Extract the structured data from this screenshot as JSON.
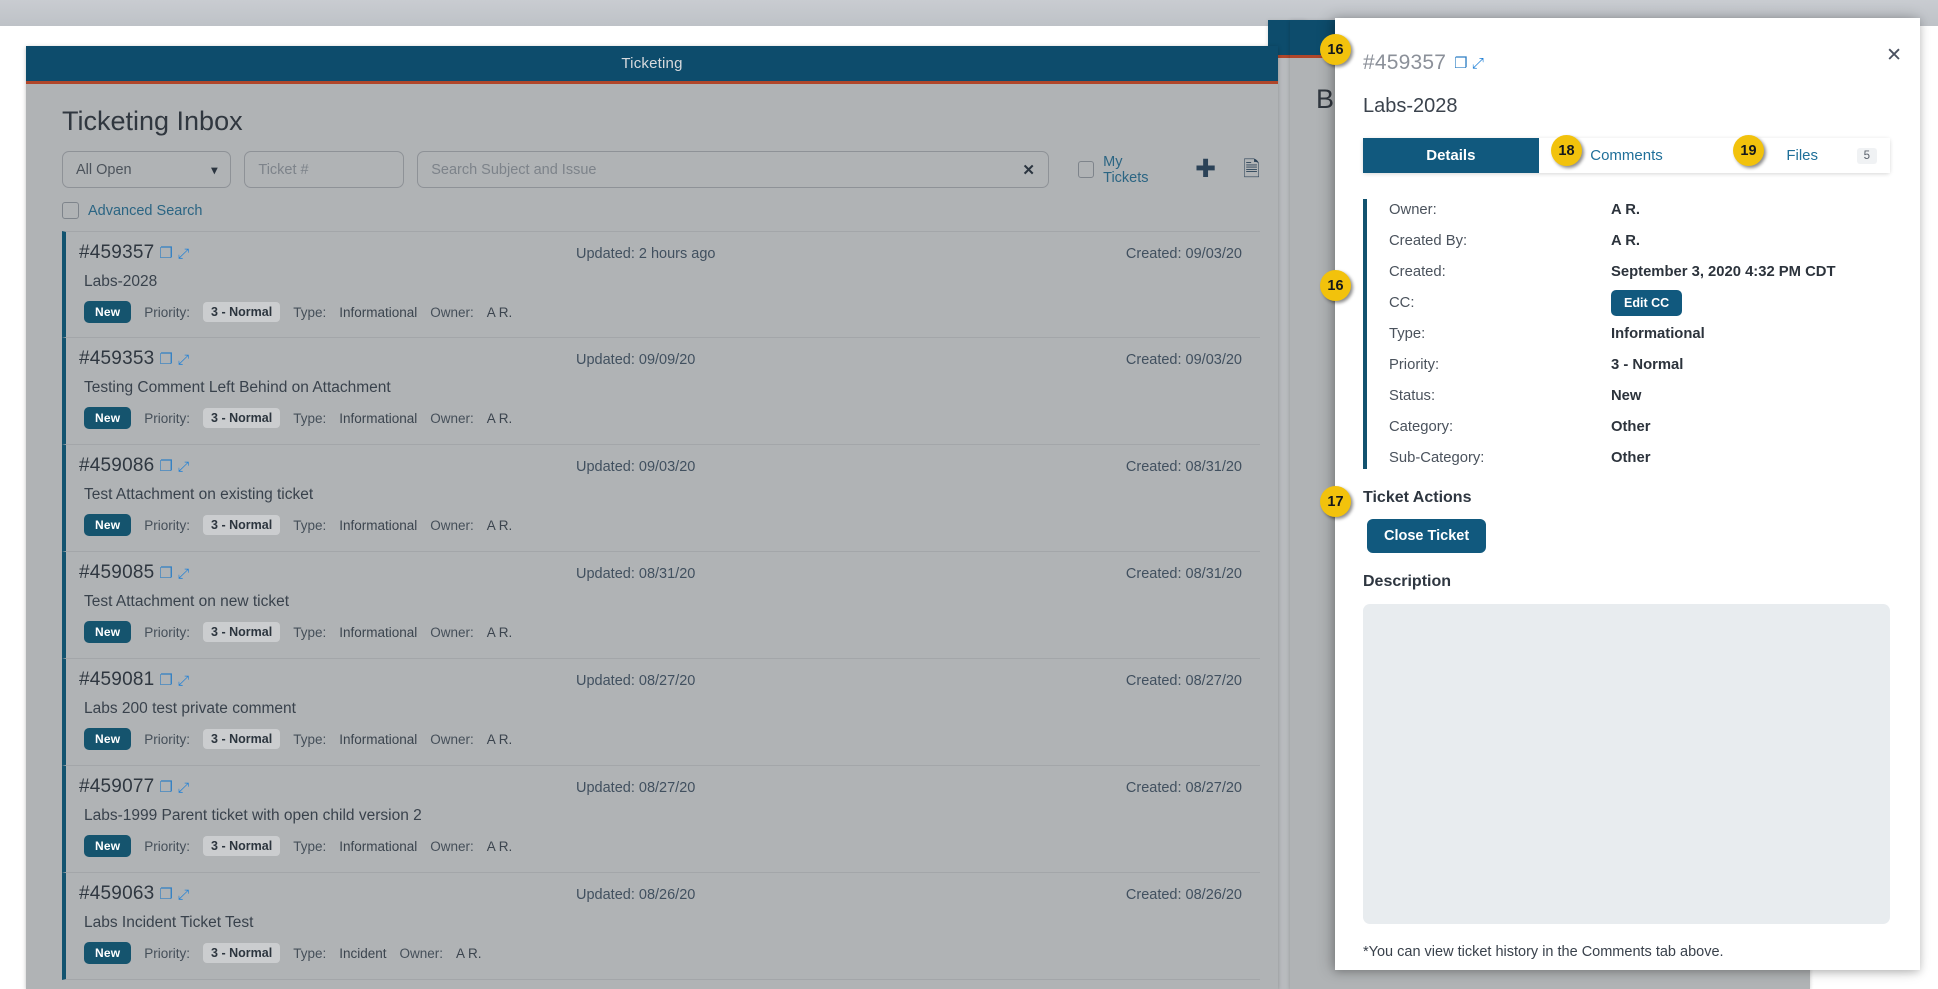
{
  "window": {
    "main_title": "Ticketing",
    "second_title": "Bo",
    "page_title": "Ticketing Inbox"
  },
  "toolbar": {
    "status_filter": "All Open",
    "caret_icon": "chevron-down",
    "ticket_number_placeholder": "Ticket #",
    "search_placeholder": "Search Subject and Issue",
    "clear_icon": "✖",
    "my_tickets_label": "My Tickets",
    "add_icon": "✚",
    "export_icon": "὜E",
    "advanced_search_label": "Advanced Search"
  },
  "tickets": [
    {
      "id": "#459357",
      "subject": "Labs-2028",
      "status": "New",
      "priority_label": "Priority:",
      "priority": "3 - Normal",
      "type_label": "Type:",
      "type": "Informational",
      "owner_label": "Owner:",
      "owner": "A R.",
      "updated": "Updated: 2 hours ago",
      "created": "Created: 09/03/20"
    },
    {
      "id": "#459353",
      "subject": "Testing Comment Left Behind on Attachment",
      "status": "New",
      "priority_label": "Priority:",
      "priority": "3 - Normal",
      "type_label": "Type:",
      "type": "Informational",
      "owner_label": "Owner:",
      "owner": "A R.",
      "updated": "Updated: 09/09/20",
      "created": "Created: 09/03/20"
    },
    {
      "id": "#459086",
      "subject": "Test Attachment on existing ticket",
      "status": "New",
      "priority_label": "Priority:",
      "priority": "3 - Normal",
      "type_label": "Type:",
      "type": "Informational",
      "owner_label": "Owner:",
      "owner": "A R.",
      "updated": "Updated: 09/03/20",
      "created": "Created: 08/31/20"
    },
    {
      "id": "#459085",
      "subject": "Test Attachment on new ticket",
      "status": "New",
      "priority_label": "Priority:",
      "priority": "3 - Normal",
      "type_label": "Type:",
      "type": "Informational",
      "owner_label": "Owner:",
      "owner": "A R.",
      "updated": "Updated: 08/31/20",
      "created": "Created: 08/31/20"
    },
    {
      "id": "#459081",
      "subject": "Labs 200 test private comment",
      "status": "New",
      "priority_label": "Priority:",
      "priority": "3 - Normal",
      "type_label": "Type:",
      "type": "Informational",
      "owner_label": "Owner:",
      "owner": "A R.",
      "updated": "Updated: 08/27/20",
      "created": "Created: 08/27/20"
    },
    {
      "id": "#459077",
      "subject": "Labs-1999 Parent ticket with open child version 2",
      "status": "New",
      "priority_label": "Priority:",
      "priority": "3 - Normal",
      "type_label": "Type:",
      "type": "Informational",
      "owner_label": "Owner:",
      "owner": "A R.",
      "updated": "Updated: 08/27/20",
      "created": "Created: 08/27/20"
    },
    {
      "id": "#459063",
      "subject": "Labs Incident Ticket Test",
      "status": "New",
      "priority_label": "Priority:",
      "priority": "3 - Normal",
      "type_label": "Type:",
      "type": "Incident",
      "owner_label": "Owner:",
      "owner": "A R.",
      "updated": "Updated: 08/26/20",
      "created": "Created: 08/26/20"
    }
  ],
  "panel": {
    "ticket_id": "#459357",
    "subject": "Labs-2028",
    "close_icon": "✕",
    "copy_icon": "❐",
    "expand_icon": "⤢",
    "tabs": [
      {
        "label": "Details",
        "count": ""
      },
      {
        "label": "Comments",
        "count": ""
      },
      {
        "label": "Files",
        "count": "5"
      }
    ],
    "details": [
      {
        "key": "Owner:",
        "value": "A R."
      },
      {
        "key": "Created By:",
        "value": "A R."
      },
      {
        "key": "Created:",
        "value": "September 3, 2020 4:32 PM CDT"
      },
      {
        "key": "CC:",
        "value": "Edit CC"
      },
      {
        "key": "Type:",
        "value": "Informational"
      },
      {
        "key": "Priority:",
        "value": "3 - Normal"
      },
      {
        "key": "Status:",
        "value": "New"
      },
      {
        "key": "Category:",
        "value": "Other"
      },
      {
        "key": "Sub-Category:",
        "value": "Other"
      }
    ],
    "ticket_actions_title": "Ticket Actions",
    "close_ticket_label": "Close Ticket",
    "description_title": "Description",
    "description_value": "",
    "footnote": "*You can view ticket history in the Comments tab above."
  },
  "callouts": [
    {
      "number": "16"
    },
    {
      "number": "16"
    },
    {
      "number": "17"
    },
    {
      "number": "18"
    },
    {
      "number": "19"
    }
  ],
  "colors": {
    "brand_dark": "#0d4c6c",
    "brand_blue": "#11597e",
    "accent_red": "#b0462a",
    "callout_yellow": "#f2c20c",
    "link_blue": "#2b6583",
    "panel_bg": "#ffffff",
    "app_bg": "#b0b3b5"
  }
}
